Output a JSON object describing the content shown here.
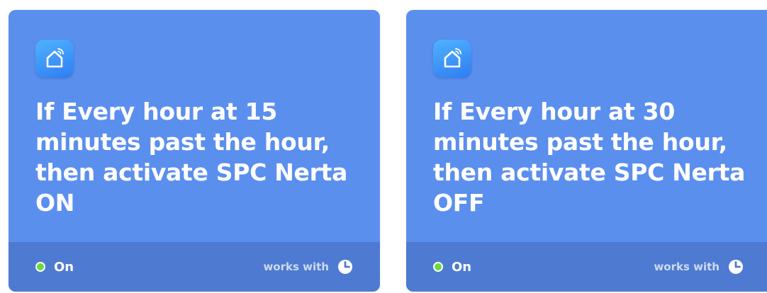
{
  "cards": [
    {
      "icon": "smart-home-icon",
      "title": "If Every hour at 15 minutes past the hour, then activate SPC Nerta ON",
      "status": "On",
      "status_color": "#6bdc3a",
      "works_with": "works with",
      "works_with_icon": "clock-icon"
    },
    {
      "icon": "smart-home-icon",
      "title": "If Every hour at 30 minutes past the hour, then activate SPC Nerta OFF",
      "status": "On",
      "status_color": "#6bdc3a",
      "works_with": "works with",
      "works_with_icon": "clock-icon"
    }
  ],
  "colors": {
    "card_background": "#5b8fee",
    "footer_background": "#4e7ad1",
    "text": "#ffffff"
  }
}
